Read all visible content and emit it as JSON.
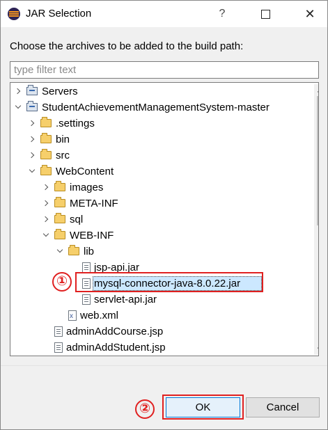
{
  "window": {
    "title": "JAR Selection",
    "help_icon": "?",
    "close_icon": "✕"
  },
  "prompt": "Choose the archives to be added to the build path:",
  "filter": {
    "placeholder": "type filter text",
    "value": ""
  },
  "tree": {
    "items": [
      {
        "label": "Servers",
        "icon": "project-folder-icon",
        "state": "collapsed",
        "level": 0
      },
      {
        "label": "StudentAchievementManagementSystem-master",
        "icon": "project-icon",
        "state": "expanded",
        "level": 0
      },
      {
        "label": ".settings",
        "icon": "folder-icon",
        "state": "collapsed",
        "level": 1
      },
      {
        "label": "bin",
        "icon": "folder-icon",
        "state": "collapsed",
        "level": 1
      },
      {
        "label": "src",
        "icon": "folder-icon",
        "state": "collapsed",
        "level": 1
      },
      {
        "label": "WebContent",
        "icon": "folder-icon",
        "state": "expanded",
        "level": 1
      },
      {
        "label": "images",
        "icon": "folder-icon",
        "state": "collapsed",
        "level": 2
      },
      {
        "label": "META-INF",
        "icon": "folder-icon",
        "state": "collapsed",
        "level": 2
      },
      {
        "label": "sql",
        "icon": "folder-icon",
        "state": "collapsed",
        "level": 2
      },
      {
        "label": "WEB-INF",
        "icon": "folder-icon",
        "state": "expanded",
        "level": 2
      },
      {
        "label": "lib",
        "icon": "folder-icon",
        "state": "expanded",
        "level": 3
      },
      {
        "label": "jsp-api.jar",
        "icon": "jar-file-icon",
        "state": "leaf",
        "level": 4
      },
      {
        "label": "mysql-connector-java-8.0.22.jar",
        "icon": "jar-file-icon",
        "state": "leaf",
        "level": 4,
        "selected": true
      },
      {
        "label": "servlet-api.jar",
        "icon": "jar-file-icon",
        "state": "leaf",
        "level": 4
      },
      {
        "label": "web.xml",
        "icon": "xml-file-icon",
        "state": "leaf",
        "level": 3
      },
      {
        "label": "adminAddCourse.jsp",
        "icon": "jsp-file-icon",
        "state": "leaf",
        "level": 2
      },
      {
        "label": "adminAddStudent.jsp",
        "icon": "jsp-file-icon",
        "state": "leaf",
        "level": 2
      }
    ]
  },
  "annotations": {
    "step1": "①",
    "step2": "②",
    "color": "#e02020"
  },
  "buttons": {
    "ok": "OK",
    "cancel": "Cancel"
  },
  "colors": {
    "selection": "#cce8ff",
    "accent": "#0078d7"
  }
}
